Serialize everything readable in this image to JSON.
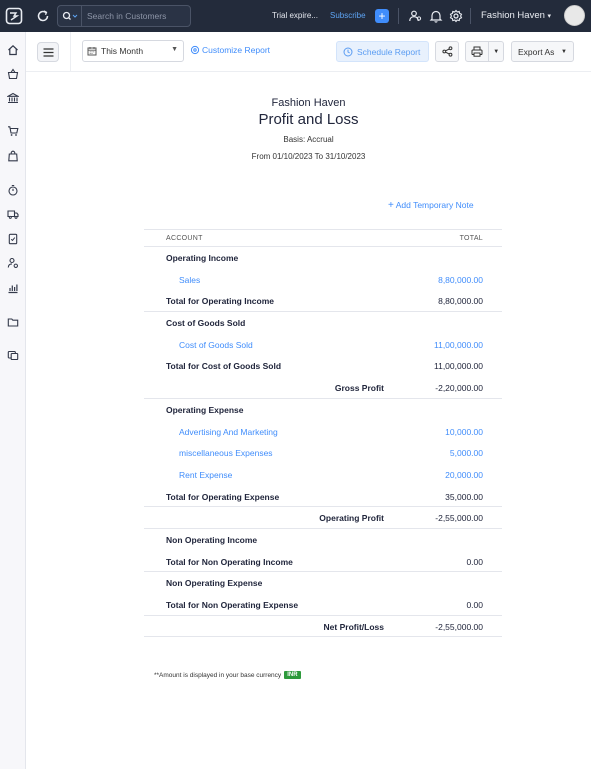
{
  "topbar": {
    "search_placeholder": "Search in Customers",
    "trial_text": "Trial expire...",
    "subscribe_label": "Subscribe",
    "add_label": "+",
    "org_name": "Fashion Haven"
  },
  "toolbar": {
    "period": "This Month",
    "customize": "Customize Report",
    "schedule": "Schedule Report",
    "export": "Export As"
  },
  "report": {
    "org": "Fashion Haven",
    "title": "Profit and Loss",
    "basis": "Basis: Accrual",
    "range": "From 01/10/2023 To 31/10/2023",
    "add_note": "Add Temporary Note",
    "col_account": "ACCOUNT",
    "col_total": "TOTAL",
    "rows": [
      {
        "type": "sec",
        "label": "Operating Income",
        "value": ""
      },
      {
        "type": "acc",
        "label": "Sales",
        "value": "8,80,000.00"
      },
      {
        "type": "tot",
        "label": "Total for Operating Income",
        "value": "8,80,000.00"
      },
      {
        "type": "sec",
        "label": "Cost of Goods Sold",
        "value": ""
      },
      {
        "type": "acc",
        "label": "Cost of Goods Sold",
        "value": "11,00,000.00"
      },
      {
        "type": "tot",
        "label": "Total for Cost of Goods Sold",
        "value": "11,00,000.00"
      },
      {
        "type": "gp",
        "label": "Gross Profit",
        "value": "-2,20,000.00"
      },
      {
        "type": "sec",
        "label": "Operating Expense",
        "value": ""
      },
      {
        "type": "acc",
        "label": "Advertising And Marketing",
        "value": "10,000.00"
      },
      {
        "type": "acc",
        "label": "miscellaneous Expenses",
        "value": "5,000.00"
      },
      {
        "type": "acc",
        "label": "Rent Expense",
        "value": "20,000.00"
      },
      {
        "type": "tot",
        "label": "Total for Operating Expense",
        "value": "35,000.00"
      },
      {
        "type": "gp",
        "label": "Operating Profit",
        "value": "-2,55,000.00"
      },
      {
        "type": "sec",
        "label": "Non Operating Income",
        "value": ""
      },
      {
        "type": "tot",
        "label": "Total for Non Operating Income",
        "value": "0.00"
      },
      {
        "type": "sec",
        "label": "Non Operating Expense",
        "value": ""
      },
      {
        "type": "tot",
        "label": "Total for Non Operating Expense",
        "value": "0.00"
      },
      {
        "type": "gp",
        "label": "Net Profit/Loss",
        "value": "-2,55,000.00"
      }
    ],
    "footnote": "**Amount is displayed in your base currency",
    "currency": "INR"
  },
  "colors": {
    "topbar": "#232b3b",
    "accent": "#408dfb",
    "currency_badge": "#2e9a3c"
  }
}
